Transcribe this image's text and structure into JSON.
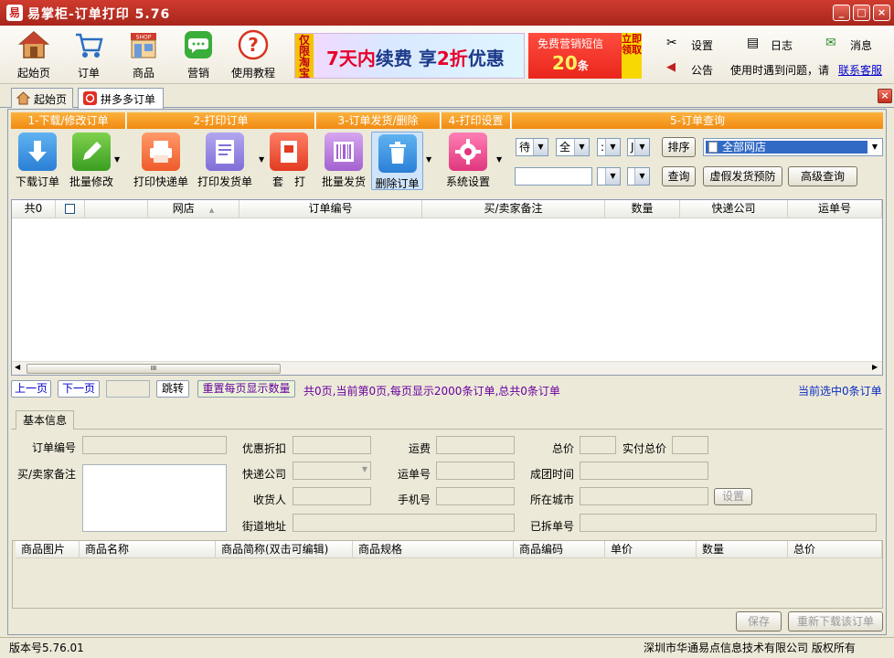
{
  "window": {
    "logo": "易",
    "title": "易掌柜-订单打印 5.76",
    "btn_min": "_",
    "btn_max": "□",
    "btn_close": "×"
  },
  "main_toolbar": [
    {
      "id": "home",
      "label": "起始页"
    },
    {
      "id": "order",
      "label": "订单"
    },
    {
      "id": "goods",
      "label": "商品"
    },
    {
      "id": "marketing",
      "label": "营销"
    },
    {
      "id": "tutorial",
      "label": "使用教程"
    }
  ],
  "ad1": {
    "vertical": "仅限淘宝",
    "text_a": "7天内",
    "text_b": "续费 享",
    "text_c": "2折",
    "text_d": "优惠"
  },
  "ad2": {
    "line1": "免费营销短信",
    "count": "20",
    "unit": "条",
    "vertical": "立即领取"
  },
  "top_links": {
    "settings": "设置",
    "log": "日志",
    "message": "消息",
    "announce": "公告",
    "help_text": "使用时遇到问题，请",
    "contact": "联系客服"
  },
  "tabs": [
    {
      "label": "起始页"
    },
    {
      "label": "拼多多订单"
    }
  ],
  "groups": [
    "1-下载/修改订单",
    "2-打印订单",
    "3-订单发货/删除",
    "4-打印设置",
    "5-订单查询"
  ],
  "tool_buttons": {
    "download": "下载订单",
    "batch_edit": "批量修改",
    "print_express": "打印快递单",
    "print_invoice": "打印发货单",
    "print_set": "套　打",
    "batch_ship": "批量发货",
    "delete": "删除订单",
    "system_settings": "系统设置"
  },
  "query": {
    "sel1": "待",
    "sel2": "全",
    "sel3": ":",
    "sel4": "J",
    "sort": "排序",
    "shop": "全部网店",
    "search": "查询",
    "fake_ship": "虚假发货预防",
    "advanced": "高级查询"
  },
  "grid_headers": [
    "共0",
    "",
    "网店",
    "订单编号",
    "买/卖家备注",
    "数量",
    "快递公司",
    "运单号"
  ],
  "scroll_thumb": "III",
  "pager": {
    "prev": "上一页",
    "next": "下一页",
    "jump": "跳转",
    "reset": "重置每页显示数量",
    "info": "共0页,当前第0页,每页显示2000条订单,总共0条订单",
    "selected": "当前选中0条订单"
  },
  "detail_tab": "基本信息",
  "fields": {
    "order_no": "订单编号",
    "remark": "买/卖家备注",
    "discount": "优惠折扣",
    "express": "快递公司",
    "receiver": "收货人",
    "street": "街道地址",
    "freight": "运费",
    "waybill": "运单号",
    "phone": "手机号",
    "total": "总价",
    "paid": "实付总价",
    "group_time": "成团时间",
    "city": "所在城市",
    "set_btn": "设置",
    "split_no": "已拆单号"
  },
  "sub_headers": [
    "商品图片",
    "商品名称",
    "商品简称(双击可编辑)",
    "商品规格",
    "商品编码",
    "单价",
    "数量",
    "总价"
  ],
  "bottom_buttons": {
    "save": "保存",
    "redownload": "重新下载该订单"
  },
  "status": {
    "version": "版本号5.76.01",
    "copyright": "深圳市华通易点信息技术有限公司 版权所有"
  },
  "colors": {
    "title_red": "#c0392b",
    "group_orange": "#f39a1e",
    "link_blue": "#0000cc"
  }
}
